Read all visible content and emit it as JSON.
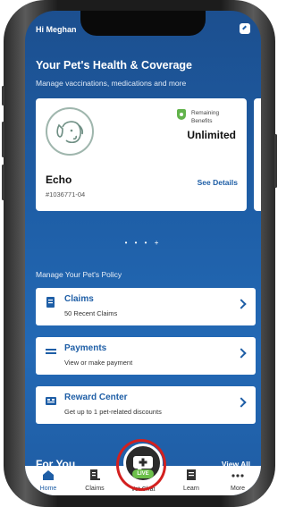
{
  "header": {
    "greeting": "Hi Meghan",
    "chat_icon": "chat-bubble-icon"
  },
  "hero": {
    "title": "Your Pet's Health & Coverage",
    "subtitle": "Manage vaccinations, medications and more"
  },
  "pet_card": {
    "name": "Echo",
    "id": "#1036771-04",
    "remaining_label": "Remaining Benefits",
    "benefit_value": "Unlimited",
    "see_details": "See Details",
    "avatar_icon": "dog-icon"
  },
  "carousel": {
    "dots": "• • • +"
  },
  "policy": {
    "section_label": "Manage Your Pet's Policy",
    "items": [
      {
        "title": "Claims",
        "sub": "50 Recent Claims",
        "icon": "document-icon"
      },
      {
        "title": "Payments",
        "sub": "View or make payment",
        "icon": "card-icon"
      },
      {
        "title": "Reward Center",
        "sub": "Get up to 1 pet-related discounts",
        "icon": "gift-icon"
      }
    ]
  },
  "for_you": {
    "title": "For You",
    "view_all": "View All"
  },
  "tabbar": {
    "tabs": [
      {
        "label": "Home",
        "icon": "home-icon"
      },
      {
        "label": "Claims",
        "icon": "claims-icon"
      },
      {
        "label": "Vet Chat",
        "icon": "vet-chat-icon"
      },
      {
        "label": "Learn",
        "icon": "learn-icon"
      },
      {
        "label": "More",
        "icon": "more-icon"
      }
    ],
    "live_badge": "LIVE"
  },
  "colors": {
    "primary": "#1e5ea6",
    "accent_green": "#6cc04a",
    "highlight_red": "#d3201f"
  }
}
